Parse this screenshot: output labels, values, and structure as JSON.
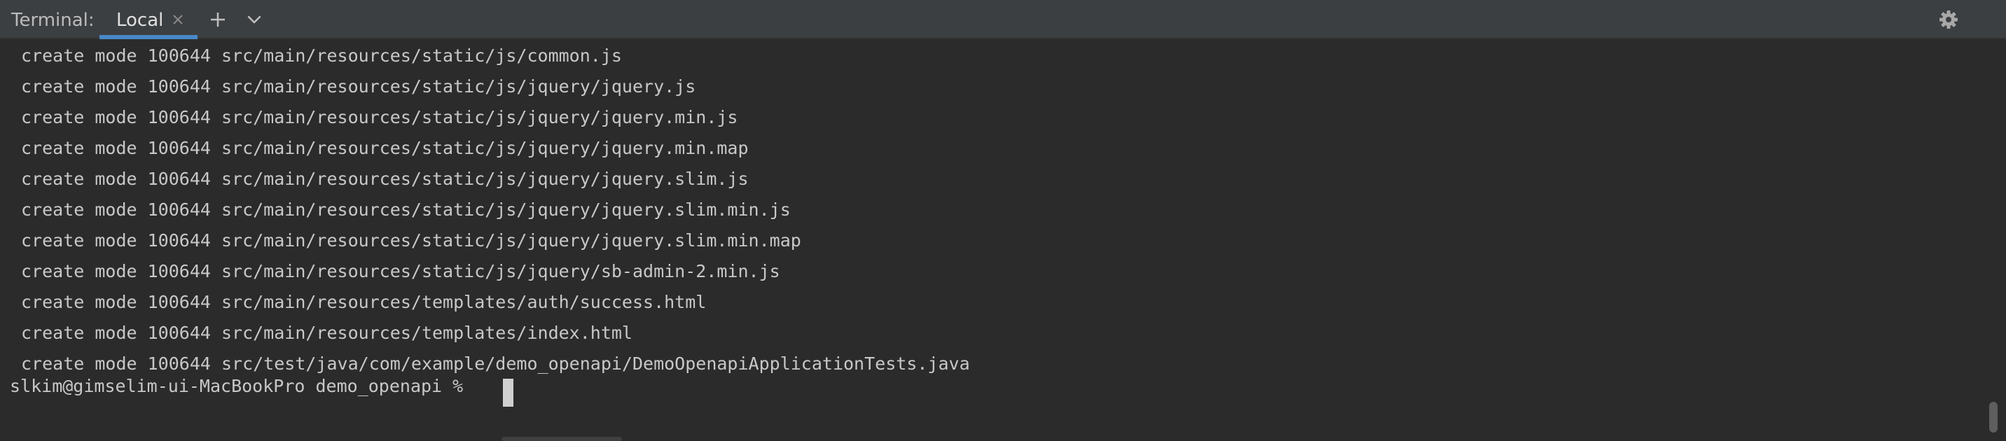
{
  "toolbar": {
    "title": "Terminal:",
    "tabs": [
      {
        "label": "Local",
        "active": true
      }
    ],
    "icons": [
      "close-icon",
      "plus-icon",
      "chevron-down-icon",
      "gear-icon"
    ]
  },
  "terminal": {
    "lines": [
      "create mode 100644 src/main/resources/static/js/common.js",
      "create mode 100644 src/main/resources/static/js/jquery/jquery.js",
      "create mode 100644 src/main/resources/static/js/jquery/jquery.min.js",
      "create mode 100644 src/main/resources/static/js/jquery/jquery.min.map",
      "create mode 100644 src/main/resources/static/js/jquery/jquery.slim.js",
      "create mode 100644 src/main/resources/static/js/jquery/jquery.slim.min.js",
      "create mode 100644 src/main/resources/static/js/jquery/jquery.slim.min.map",
      "create mode 100644 src/main/resources/static/js/jquery/sb-admin-2.min.js",
      "create mode 100644 src/main/resources/templates/auth/success.html",
      "create mode 100644 src/main/resources/templates/index.html",
      "create mode 100644 src/test/java/com/example/demo_openapi/DemoOpenapiApplicationTests.java"
    ],
    "prompt": "slkim@gimselim-ui-MacBookPro demo_openapi % "
  },
  "colors": {
    "toolbar_bg": "#3c3f41",
    "terminal_bg": "#2b2b2b",
    "text": "#c8c8c8",
    "accent": "#4a88c7"
  }
}
